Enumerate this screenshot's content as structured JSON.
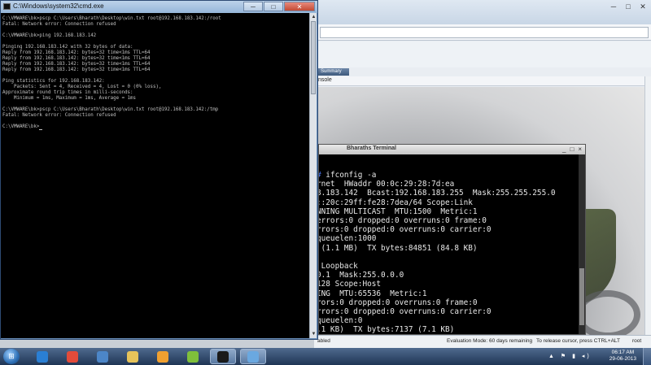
{
  "cmd": {
    "title": "C:\\Windows\\system32\\cmd.exe",
    "lines": [
      "C:\\VMWARE\\bk>pscp C:\\Users\\Bharath\\Desktop\\win.txt root@192.168.183.142:/root",
      "Fatal: Network error: Connection refused",
      "",
      "C:\\VMWARE\\bk>ping 192.168.183.142",
      "",
      "Pinging 192.168.183.142 with 32 bytes of data:",
      "Reply from 192.168.183.142: bytes=32 time<1ms TTL=64",
      "Reply from 192.168.183.142: bytes=32 time<1ms TTL=64",
      "Reply from 192.168.183.142: bytes=32 time<1ms TTL=64",
      "Reply from 192.168.183.142: bytes=32 time<1ms TTL=64",
      "",
      "Ping statistics for 192.168.183.142:",
      "    Packets: Sent = 4, Received = 4, Lost = 0 (0% loss),",
      "Approximate round trip times in milli-seconds:",
      "    Minimum = 1ms, Maximum = 1ms, Average = 1ms",
      "",
      "C:\\VMWARE\\bk>pscp C:\\Users\\Bharath\\Desktop\\win.txt root@192.168.183.142:/tmp",
      "Fatal: Network error: Connection refused",
      "",
      "C:\\VMWARE\\bk>"
    ],
    "controls": {
      "minimize": "─",
      "maximize": "□",
      "close": "✕"
    }
  },
  "vmware": {
    "tab_label": "Summary",
    "console_label": "nsole",
    "status": {
      "left": "abled",
      "evaluation": "Evaluation Mode: 60 days remaining",
      "hint": "To release cursor, press CTRL+ALT",
      "user": "root"
    }
  },
  "terminal": {
    "title": "Bharaths Terminal",
    "controls": {
      "minimize": "_",
      "maximize": "□",
      "close": "×"
    },
    "prompt_line": "# ifconfig -a",
    "lines": [
      "rnet  HWaddr 00:0c:29:28:7d:ea",
      "8.183.142  Bcast:192.168.183.255  Mask:255.255.255.0",
      "::20c:29ff:fe28:7dea/64 Scope:Link",
      "NNING MULTICAST  MTU:1500  Metric:1",
      "errors:0 dropped:0 overruns:0 frame:0",
      "rrors:0 dropped:0 overruns:0 carrier:0",
      "queuelen:1000",
      " (1.1 MB)  TX bytes:84851 (84.8 KB)",
      "",
      " Loopback",
      "0.1  Mask:255.0.0.0",
      "128 Scope:Host",
      "ING  MTU:65536  Metric:1",
      "rors:0 dropped:0 overruns:0 frame:0",
      "rrors:0 dropped:0 overruns:0 carrier:0",
      "queuelen:0",
      ".1 KB)  TX bytes:7137 (7.1 KB)"
    ]
  },
  "taskbar": {
    "clock_time": "06:17 AM",
    "clock_date": "29-06-2013",
    "apps": [
      {
        "name": "internet-explorer-icon",
        "color": "#2a7fd4",
        "active": false
      },
      {
        "name": "chrome-icon",
        "color": "#e34b3a",
        "active": false
      },
      {
        "name": "vmware-manager-icon",
        "color": "#4c86c8",
        "active": false
      },
      {
        "name": "file-explorer-icon",
        "color": "#e6c35a",
        "active": false
      },
      {
        "name": "vmware-workstation-icon",
        "color": "#f0a030",
        "active": false
      },
      {
        "name": "opera-icon",
        "color": "#7fbf3b",
        "active": false
      },
      {
        "name": "cmd-icon",
        "color": "#1a1a1a",
        "active": true
      },
      {
        "name": "remote-desktop-icon",
        "color": "#6aa8e0",
        "active": true
      }
    ]
  }
}
